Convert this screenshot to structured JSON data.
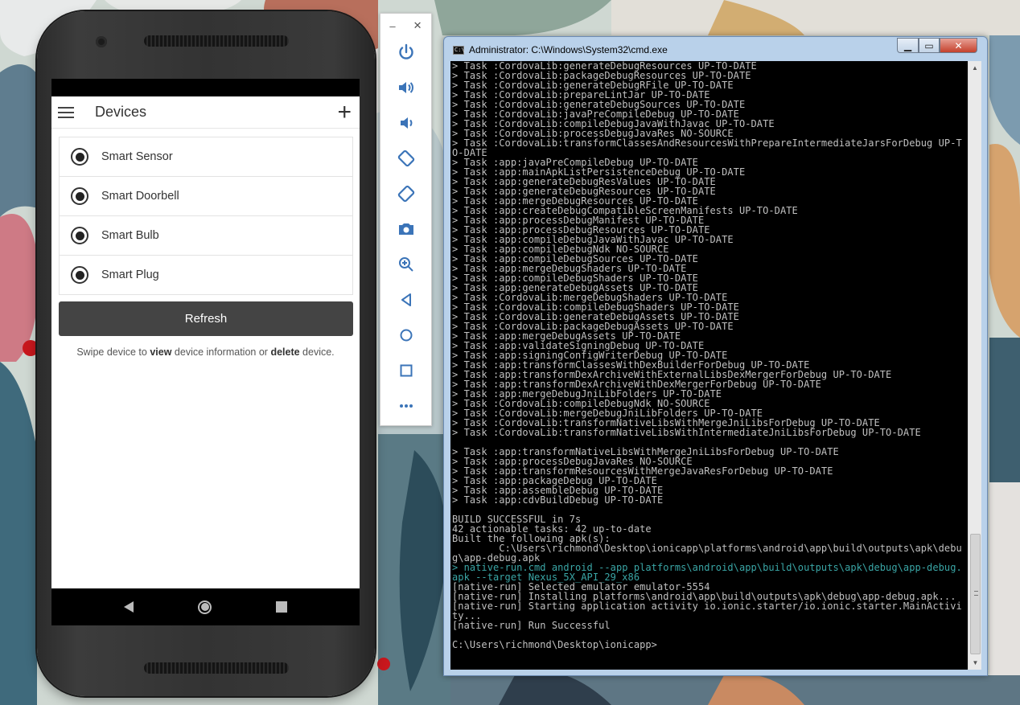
{
  "phone": {
    "app_title": "Devices",
    "devices": [
      "Smart Sensor",
      "Smart Doorbell",
      "Smart Bulb",
      "Smart Plug"
    ],
    "refresh_label": "Refresh",
    "hint": {
      "p1": "Swipe device to ",
      "b1": "view",
      "p2": " device information or ",
      "b2": "delete",
      "p3": " device."
    }
  },
  "toolbar": {
    "minimize": "–",
    "close": "✕",
    "buttons": [
      "power-icon",
      "volume-up-icon",
      "volume-down-icon",
      "rotate-left-icon",
      "rotate-right-icon",
      "camera-icon",
      "zoom-icon",
      "back-icon",
      "home-icon",
      "overview-icon",
      "more-icon"
    ]
  },
  "cmd": {
    "title": "Administrator: C:\\Windows\\System32\\cmd.exe",
    "icon_text": "C:\\",
    "lines": [
      "> Task :CordovaLib:generateDebugResources UP-TO-DATE",
      "> Task :CordovaLib:packageDebugResources UP-TO-DATE",
      "> Task :CordovaLib:generateDebugRFile UP-TO-DATE",
      "> Task :CordovaLib:prepareLintJar UP-TO-DATE",
      "> Task :CordovaLib:generateDebugSources UP-TO-DATE",
      "> Task :CordovaLib:javaPreCompileDebug UP-TO-DATE",
      "> Task :CordovaLib:compileDebugJavaWithJavac UP-TO-DATE",
      "> Task :CordovaLib:processDebugJavaRes NO-SOURCE",
      "> Task :CordovaLib:transformClassesAndResourcesWithPrepareIntermediateJarsForDebug UP-TO-DATE",
      "> Task :app:javaPreCompileDebug UP-TO-DATE",
      "> Task :app:mainApkListPersistenceDebug UP-TO-DATE",
      "> Task :app:generateDebugResValues UP-TO-DATE",
      "> Task :app:generateDebugResources UP-TO-DATE",
      "> Task :app:mergeDebugResources UP-TO-DATE",
      "> Task :app:createDebugCompatibleScreenManifests UP-TO-DATE",
      "> Task :app:processDebugManifest UP-TO-DATE",
      "> Task :app:processDebugResources UP-TO-DATE",
      "> Task :app:compileDebugJavaWithJavac UP-TO-DATE",
      "> Task :app:compileDebugNdk NO-SOURCE",
      "> Task :app:compileDebugSources UP-TO-DATE",
      "> Task :app:mergeDebugShaders UP-TO-DATE",
      "> Task :app:compileDebugShaders UP-TO-DATE",
      "> Task :app:generateDebugAssets UP-TO-DATE",
      "> Task :CordovaLib:mergeDebugShaders UP-TO-DATE",
      "> Task :CordovaLib:compileDebugShaders UP-TO-DATE",
      "> Task :CordovaLib:generateDebugAssets UP-TO-DATE",
      "> Task :CordovaLib:packageDebugAssets UP-TO-DATE",
      "> Task :app:mergeDebugAssets UP-TO-DATE",
      "> Task :app:validateSigningDebug UP-TO-DATE",
      "> Task :app:signingConfigWriterDebug UP-TO-DATE",
      "> Task :app:transformClassesWithDexBuilderForDebug UP-TO-DATE",
      "> Task :app:transformDexArchiveWithExternalLibsDexMergerForDebug UP-TO-DATE",
      "> Task :app:transformDexArchiveWithDexMergerForDebug UP-TO-DATE",
      "> Task :app:mergeDebugJniLibFolders UP-TO-DATE",
      "> Task :CordovaLib:compileDebugNdk NO-SOURCE",
      "> Task :CordovaLib:mergeDebugJniLibFolders UP-TO-DATE",
      "> Task :CordovaLib:transformNativeLibsWithMergeJniLibsForDebug UP-TO-DATE",
      "> Task :CordovaLib:transformNativeLibsWithIntermediateJniLibsForDebug UP-TO-DATE",
      "",
      "> Task :app:transformNativeLibsWithMergeJniLibsForDebug UP-TO-DATE",
      "> Task :app:processDebugJavaRes NO-SOURCE",
      "> Task :app:transformResourcesWithMergeJavaResForDebug UP-TO-DATE",
      "> Task :app:packageDebug UP-TO-DATE",
      "> Task :app:assembleDebug UP-TO-DATE",
      "> Task :app:cdvBuildDebug UP-TO-DATE",
      "",
      "BUILD SUCCESSFUL in 7s",
      "42 actionable tasks: 42 up-to-date",
      "Built the following apk(s):",
      "        C:\\Users\\richmond\\Desktop\\ionicapp\\platforms\\android\\app\\build\\outputs\\apk\\debug\\app-debug.apk",
      "> native-run.cmd android --app platforms\\android\\app\\build\\outputs\\apk\\debug\\app-debug.apk --target Nexus_5X_API_29_x86",
      "[native-run] Selected emulator emulator-5554",
      "[native-run] Installing platforms\\android\\app\\build\\outputs\\apk\\debug\\app-debug.apk...",
      "[native-run] Starting application activity io.ionic.starter/io.ionic.starter.MainActivity...",
      "[native-run] Run Successful",
      "",
      "C:\\Users\\richmond\\Desktop\\ionicapp>"
    ],
    "highlight_line_index": 50,
    "highlight_color": "#3aa6a6",
    "text_color": "#c0c0c0"
  }
}
